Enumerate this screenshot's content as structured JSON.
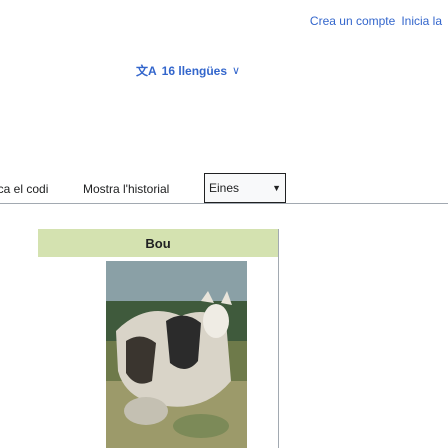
{
  "header": {
    "create_account": "Crea un compte",
    "login": "Inicia la"
  },
  "language_button": {
    "label": "16 llengües",
    "icon": "translate-icon"
  },
  "tabs": {
    "view_source": "ica el codi",
    "history": "Mostra l'historial",
    "tools": "Eines"
  },
  "infobox": {
    "title": "Bou",
    "header_color": "#d4e2b0",
    "image": "cattle-photo"
  },
  "colors": {
    "link": "#3366cc",
    "text": "#202122",
    "border": "#a2a9b1"
  }
}
